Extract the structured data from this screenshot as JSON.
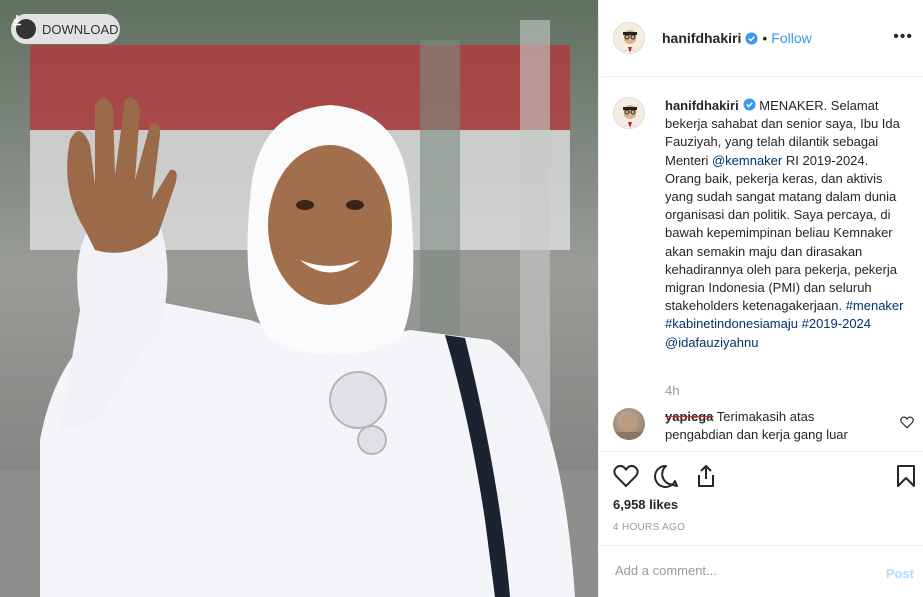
{
  "photo": {
    "download_label": "DOWNLOAD",
    "icon": "download-icon"
  },
  "header": {
    "username": "hanifdhakiri",
    "separator": "•",
    "follow_label": "Follow",
    "more_label": "•••",
    "verified_icon": "verified-badge-icon"
  },
  "caption": {
    "username": "hanifdhakiri",
    "text_1": " MENAKER. Selamat bekerja sahabat dan senior saya, Ibu Ida Fauziyah, yang telah dilantik sebagai Menteri ",
    "mention_1": "@kemnaker",
    "text_2": " RI 2019-2024. Orang baik, pekerja keras, dan aktivis yang sudah sangat matang dalam dunia organisasi dan politik. Saya percaya, di bawah kepemimpinan beliau Kemnaker akan semakin maju dan dirasakan kehadirannya oleh para pekerja, pekerja migran Indonesia (PMI) dan seluruh stakeholders ketenagakerjaan. ",
    "hashtag_1": "#menaker",
    "hashtag_2": "#kabinetindonesiamaju",
    "hashtag_3": "#2019-2024",
    "mention_2": "@idafauziyahnu",
    "time": "4h"
  },
  "comment": {
    "username": "yapiega",
    "text": " Terimakasih atas pengabdian dan kerja gang luar"
  },
  "actions": {
    "like_icon": "heart-icon",
    "comment_icon": "comment-icon",
    "share_icon": "share-icon",
    "save_icon": "bookmark-icon"
  },
  "likes": "6,958 likes",
  "posted": "4 HOURS AGO",
  "add_comment": {
    "placeholder": "Add a comment...",
    "post_label": "Post"
  },
  "colors": {
    "link": "#3897f0",
    "hashtag": "#003569",
    "post_disabled": "#b3dbff",
    "strike": "#e0261b"
  }
}
